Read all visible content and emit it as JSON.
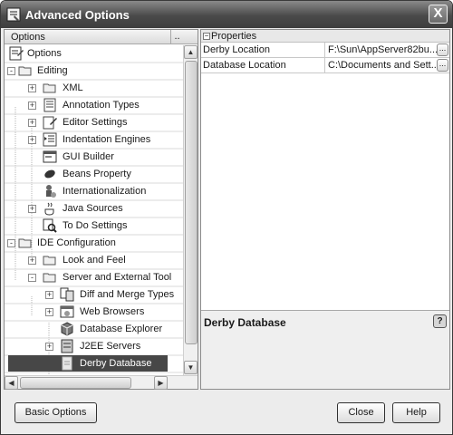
{
  "window": {
    "title": "Advanced Options",
    "close_label": "X"
  },
  "options_panel": {
    "header": "Options",
    "header_more": "..",
    "tree": [
      {
        "label": "Options",
        "icon": "options-icon",
        "expander": ""
      },
      {
        "label": "Editing",
        "icon": "folder-icon",
        "expander": "-"
      },
      {
        "label": "XML",
        "icon": "folder-icon",
        "expander": "+"
      },
      {
        "label": "Annotation Types",
        "icon": "list-icon",
        "expander": "+"
      },
      {
        "label": "Editor Settings",
        "icon": "edit-icon",
        "expander": "+"
      },
      {
        "label": "Indentation Engines",
        "icon": "indent-icon",
        "expander": "+"
      },
      {
        "label": "GUI Builder",
        "icon": "form-icon",
        "expander": ""
      },
      {
        "label": "Beans Property",
        "icon": "bean-icon",
        "expander": ""
      },
      {
        "label": "Internationalization",
        "icon": "i18n-icon",
        "expander": ""
      },
      {
        "label": "Java Sources",
        "icon": "java-icon",
        "expander": "+"
      },
      {
        "label": "To Do Settings",
        "icon": "todo-icon",
        "expander": ""
      },
      {
        "label": "IDE Configuration",
        "icon": "folder-icon",
        "expander": "-"
      },
      {
        "label": "Look and Feel",
        "icon": "folder-icon",
        "expander": "+"
      },
      {
        "label": "Server and External Tool",
        "icon": "folder-icon",
        "expander": "-"
      },
      {
        "label": "Diff and Merge Types",
        "icon": "diff-icon",
        "expander": "+"
      },
      {
        "label": "Web Browsers",
        "icon": "browser-icon",
        "expander": "+"
      },
      {
        "label": "Database Explorer",
        "icon": "database-icon",
        "expander": ""
      },
      {
        "label": "J2EE Servers",
        "icon": "server-icon",
        "expander": "+"
      },
      {
        "label": "Derby Database",
        "icon": "derby-icon",
        "expander": "",
        "selected": true
      }
    ]
  },
  "properties_panel": {
    "header": "Properties",
    "rows": [
      {
        "name": "Derby Location",
        "value": "F:\\Sun\\AppServer82bu...",
        "button": "..."
      },
      {
        "name": "Database Location",
        "value": "C:\\Documents and Sett...",
        "button": "..."
      }
    ],
    "description_title": "Derby Database",
    "help_label": "?"
  },
  "buttons": {
    "basic_options": "Basic Options",
    "close": "Close",
    "help": "Help"
  },
  "colors": {
    "selection": "#474747",
    "titlebar": "#4a4a4a",
    "window_bg": "#ececec"
  }
}
